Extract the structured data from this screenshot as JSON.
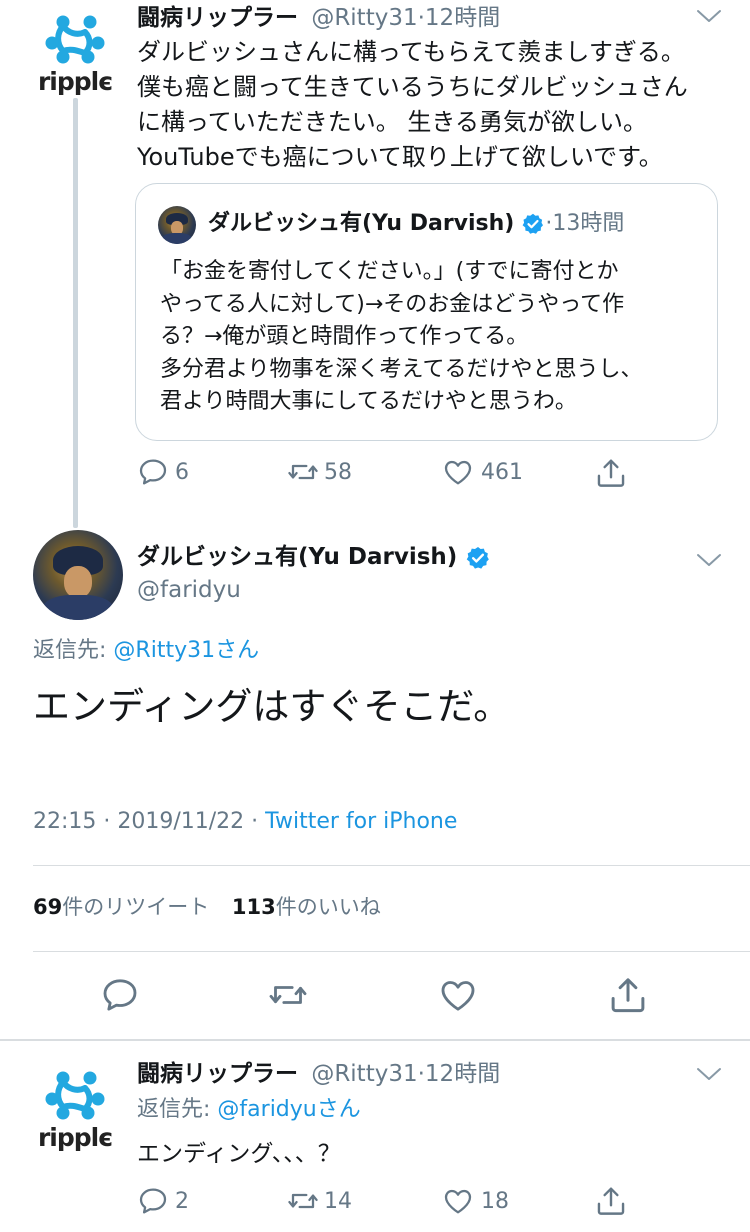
{
  "tweet1": {
    "name": "闘病リップラー",
    "handle": "@Ritty31",
    "time": "12時間",
    "avatar_brand": "ripple",
    "lines": [
      "ダルビッシュさんに構ってもらえて羨ましすぎる。",
      "僕も癌と闘って生きているうちにダルビッシュさん",
      "に構っていただきたい。 生きる勇気が欲しい。",
      "YouTubeでも癌について取り上げて欲しいです。"
    ],
    "quote": {
      "name": "ダルビッシュ有(Yu Darvish)",
      "time": "13時間",
      "lines": [
        "「お金を寄付してください。」(すでに寄付とか",
        "やってる人に対して)→そのお金はどうやって作",
        "る？→俺が頭と時間作って作ってる。",
        "多分君より物事を深く考えてるだけやと思うし、",
        "君より時間大事にしてるだけやと思うわ。"
      ]
    },
    "replies": "6",
    "retweets": "58",
    "likes": "461"
  },
  "main_tweet": {
    "name": "ダルビッシュ有(Yu Darvish)",
    "handle": "@faridyu",
    "reply_prefix": "返信先:",
    "reply_to": "@Ritty31さん",
    "text": "エンディングはすぐそこだ。",
    "timestamp": "22:15 · 2019/11/22 · ",
    "source": "Twitter for iPhone",
    "retweet_count": "69",
    "retweet_label": "件のリツイート",
    "like_count": "113",
    "like_label": "件のいいね"
  },
  "tweet3": {
    "name": "闘病リップラー",
    "handle": "@Ritty31",
    "time": "12時間",
    "avatar_brand": "ripple",
    "reply_prefix": "返信先:",
    "reply_to": "@faridyuさん",
    "text": "エンディング、、、？",
    "replies": "2",
    "retweets": "14",
    "likes": "18"
  },
  "colors": {
    "link": "#1b95e0",
    "secondary": "#657786",
    "verified": "#1da1f2",
    "ripple_blue": "#23a8e0"
  }
}
